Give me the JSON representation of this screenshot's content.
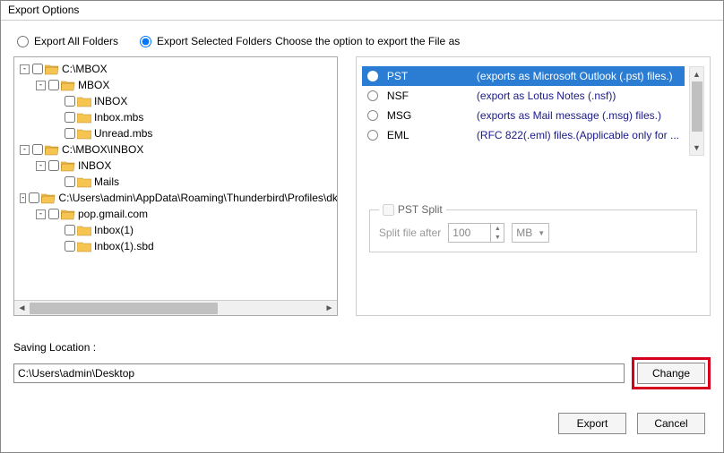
{
  "title": "Export Options",
  "radio": {
    "all": "Export All Folders",
    "selected": "Export Selected Folders"
  },
  "tree": [
    {
      "indent": 0,
      "exp": "-",
      "label": "C:\\MBOX"
    },
    {
      "indent": 1,
      "exp": "-",
      "label": "MBOX"
    },
    {
      "indent": 2,
      "exp": "",
      "label": "INBOX"
    },
    {
      "indent": 2,
      "exp": "",
      "label": "Inbox.mbs"
    },
    {
      "indent": 2,
      "exp": "",
      "label": "Unread.mbs"
    },
    {
      "indent": 0,
      "exp": "-",
      "label": "C:\\MBOX\\INBOX"
    },
    {
      "indent": 1,
      "exp": "-",
      "label": "INBOX"
    },
    {
      "indent": 2,
      "exp": "",
      "label": "Mails"
    },
    {
      "indent": 0,
      "exp": "-",
      "label": "C:\\Users\\admin\\AppData\\Roaming\\Thunderbird\\Profiles\\dkid"
    },
    {
      "indent": 1,
      "exp": "-",
      "label": "pop.gmail.com"
    },
    {
      "indent": 2,
      "exp": "",
      "label": "Inbox(1)"
    },
    {
      "indent": 2,
      "exp": "",
      "label": "Inbox(1).sbd"
    }
  ],
  "choose_label": "Choose the option to export the File as",
  "formats": [
    {
      "name": "PST",
      "desc": "(exports as Microsoft Outlook (.pst) files.)",
      "selected": true
    },
    {
      "name": "NSF",
      "desc": "(export as Lotus Notes (.nsf))",
      "selected": false
    },
    {
      "name": "MSG",
      "desc": "(exports as Mail message (.msg) files.)",
      "selected": false
    },
    {
      "name": "EML",
      "desc": "(RFC 822(.eml) files.(Applicable only for ...",
      "selected": false
    }
  ],
  "pstsplit": {
    "legend": "PST Split",
    "label": "Split file after",
    "value": "100",
    "unit": "MB"
  },
  "saving": {
    "label": "Saving Location :",
    "path": "C:\\Users\\admin\\Desktop",
    "change": "Change"
  },
  "buttons": {
    "export": "Export",
    "cancel": "Cancel"
  }
}
